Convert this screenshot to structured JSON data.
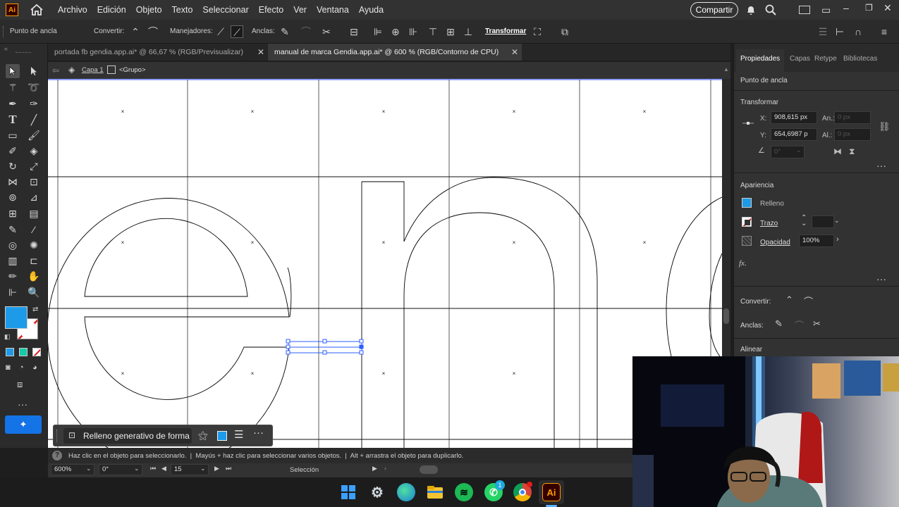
{
  "app": {
    "logo": "Ai"
  },
  "menu": [
    "Archivo",
    "Edición",
    "Objeto",
    "Texto",
    "Seleccionar",
    "Efecto",
    "Ver",
    "Ventana",
    "Ayuda"
  ],
  "share_label": "Compartir",
  "controlbar": {
    "anchor_label": "Punto de ancla",
    "convert_label": "Convertir:",
    "handles_label": "Manejadores:",
    "anchors_label": "Anclas:",
    "transform_label": "Transformar"
  },
  "tabs": [
    {
      "label": "portada fb gendia.app.ai* @ 66,67 % (RGB/Previsualizar)"
    },
    {
      "label": "manual de marca Gendia.app.ai* @ 600 % (RGB/Contorno de CPU)"
    }
  ],
  "breadcrumb": {
    "layer": "Capa 1",
    "group": "<Grupo>"
  },
  "panel": {
    "tabs": [
      "Propiedades",
      "Capas",
      "Retype",
      "Bibliotecas"
    ],
    "selection_type": "Punto de ancla",
    "transform_title": "Transformar",
    "x_label": "X:",
    "x_value": "908,615 px",
    "y_label": "Y:",
    "y_value": "654,6987 p",
    "w_label": "An.:",
    "w_value": "0 px",
    "h_label": "Al.:",
    "h_value": "0 px",
    "angle_value": "0°",
    "appearance_title": "Apariencia",
    "fill_label": "Relleno",
    "stroke_label": "Trazo",
    "opacity_label": "Opacidad",
    "opacity_value": "100%",
    "fx_label": "fx.",
    "convert_label": "Convertir:",
    "anchors_label": "Anclas:",
    "align_title": "Alinear"
  },
  "colors": {
    "fill": "#1e9be8",
    "accent": "#1473e6",
    "selection": "#2b5cff"
  },
  "floatbar": {
    "label": "Relleno generativo de forma"
  },
  "status": {
    "hint": "Haz clic en el objeto para seleccionarlo.  |  Mayús + haz clic para seleccionar varios objetos.  |  Alt + arrastra el objeto para duplicarlo."
  },
  "zoombar": {
    "zoom": "600%",
    "rotation": "0°",
    "artboard": "15",
    "tool": "Selección"
  },
  "taskbar": {
    "apps": [
      "windows-start",
      "settings",
      "edge",
      "file-explorer",
      "spotify",
      "whatsapp",
      "chrome",
      "illustrator"
    ],
    "whatsapp_badge": "1",
    "illustrator_label": "Ai"
  }
}
